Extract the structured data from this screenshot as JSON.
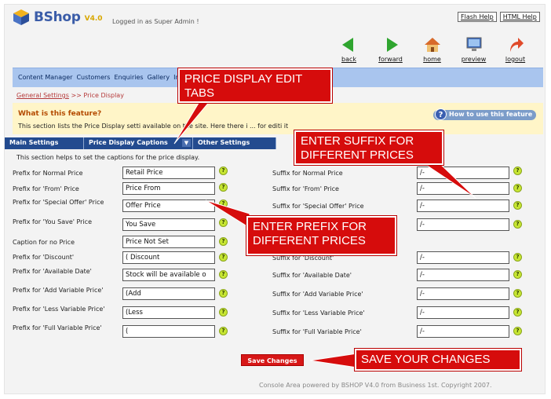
{
  "app": {
    "name": "BShop",
    "version": "V4.0",
    "logged_in": "Logged in as Super Admin !"
  },
  "help": {
    "flash": "Flash Help",
    "html": "HTML Help"
  },
  "toolbar": [
    {
      "icon": "back-arrow-icon",
      "label": "back",
      "color": "#2fa52f"
    },
    {
      "icon": "forward-arrow-icon",
      "label": "forward",
      "color": "#2fa52f"
    },
    {
      "icon": "home-icon",
      "label": "home",
      "color": "#d86a2a"
    },
    {
      "icon": "monitor-icon",
      "label": "preview",
      "color": "#3a68b8"
    },
    {
      "icon": "logout-arrow-icon",
      "label": "logout",
      "color": "#e04a2a"
    }
  ],
  "nav": [
    "Content Manager",
    "Customers",
    "Enquiries",
    "Gallery",
    "Inve"
  ],
  "breadcrumb": {
    "link": "General Settings",
    "current": ">> Price Display"
  },
  "info": {
    "title": "What is this feature?",
    "desc": "This section lists the Price Display setti      available on the site. Here there i        ...        for editi  it",
    "howto": "How to use this feature"
  },
  "tabs": {
    "main": "Main Settings",
    "captions": "Price Display Captions",
    "other": "Other Settings",
    "dropdown": "▼"
  },
  "section_help": "This section helps to set the captions for the price display.",
  "prefix_rows": [
    {
      "label": "Prefix for Normal Price",
      "value": "Retail Price"
    },
    {
      "label": "Prefix for 'From' Price",
      "value": "Price From"
    },
    {
      "label": "Prefix for 'Special Offer' Price",
      "value": "Offer Price"
    },
    {
      "label": "Prefix for 'You Save' Price",
      "value": "You Save"
    },
    {
      "label": "Caption for no Price",
      "value": "Price Not Set"
    },
    {
      "label": "Prefix for 'Discount'",
      "value": "( Discount"
    },
    {
      "label": "Prefix for 'Available Date'",
      "value": "Stock will be available o"
    },
    {
      "label": "Prefix for 'Add Variable Price'",
      "value": "(Add"
    },
    {
      "label": "Prefix for 'Less Variable Price'",
      "value": "(Less"
    },
    {
      "label": "Prefix for 'Full Variable Price'",
      "value": "("
    }
  ],
  "suffix_rows": [
    {
      "label": "Suffix for Normal Price",
      "value": "/-"
    },
    {
      "label": "Suffix for 'From' Price",
      "value": "/-"
    },
    {
      "label": "Suffix for 'Special Offer' Price",
      "value": "/-"
    },
    {
      "label": "",
      "value": "/-"
    },
    {
      "label": "Suffix for 'Discount'",
      "value": "/-"
    },
    {
      "label": "Suffix for 'Available Date'",
      "value": "/-"
    },
    {
      "label": "Suffix for 'Add Variable Price'",
      "value": "/-"
    },
    {
      "label": "Suffix for 'Less Variable Price'",
      "value": "/-"
    },
    {
      "label": "Suffix for 'Full Variable Price'",
      "value": "/-"
    }
  ],
  "help_mark": "?",
  "save_label": "Save Changes",
  "footer": "Console Area powered by BSHOP V4.0 from Business 1st. Copyright 2007.",
  "callouts": {
    "tabs": "PRICE DISPLAY EDIT TABS",
    "suffix": "ENTER SUFFIX FOR DIFFERENT PRICES",
    "prefix": "ENTER PREFIX FOR DIFFERENT PRICES",
    "save": "SAVE YOUR CHANGES"
  }
}
